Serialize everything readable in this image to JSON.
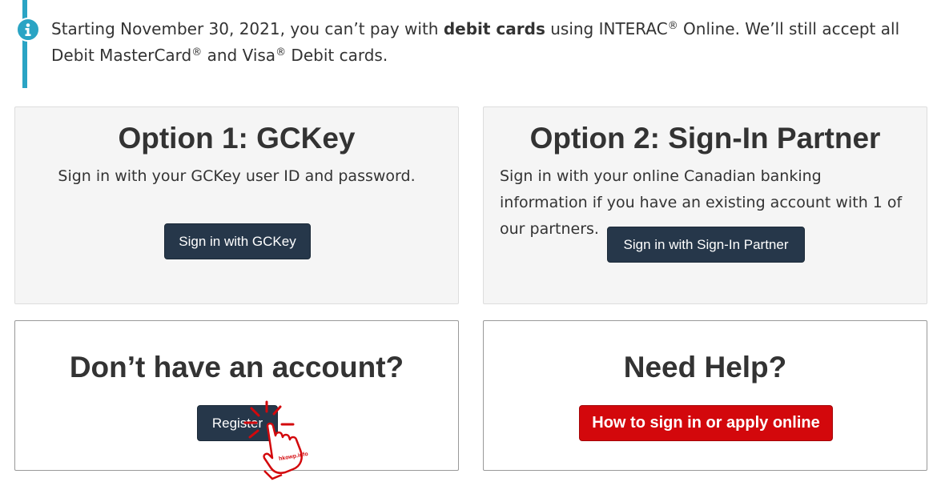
{
  "notice": {
    "icon": "info-icon",
    "accent_color": "#2aa4c4",
    "text_1": "Starting November 30, 2021, you can’t pay with ",
    "bold": "debit cards",
    "text_2": " using INTERAC",
    "reg_1": "®",
    "text_3": " Online. We’ll still accept all Debit MasterCard",
    "reg_2": "®",
    "text_4": " and Visa",
    "reg_3": "®",
    "text_5": " Debit cards."
  },
  "option1": {
    "title": "Option 1: GCKey",
    "description": "Sign in with your GCKey user ID and password.",
    "button": "Sign in with GCKey"
  },
  "option2": {
    "title": "Option 2: Sign-In Partner",
    "description": "Sign in with your online Canadian banking information if you have an existing account with 1 of our partners.",
    "button": "Sign in with Sign-In Partner"
  },
  "register": {
    "title": "Don’t have an account?",
    "button": "Register"
  },
  "help": {
    "title": "Need Help?",
    "button": "How to sign in or apply online",
    "button_color": "#d3080c"
  },
  "colors": {
    "primary_button": "#26374a",
    "text": "#333333"
  },
  "watermark": {
    "icon": "pointing-hand-cursor-icon",
    "text": "hkowp.info"
  }
}
